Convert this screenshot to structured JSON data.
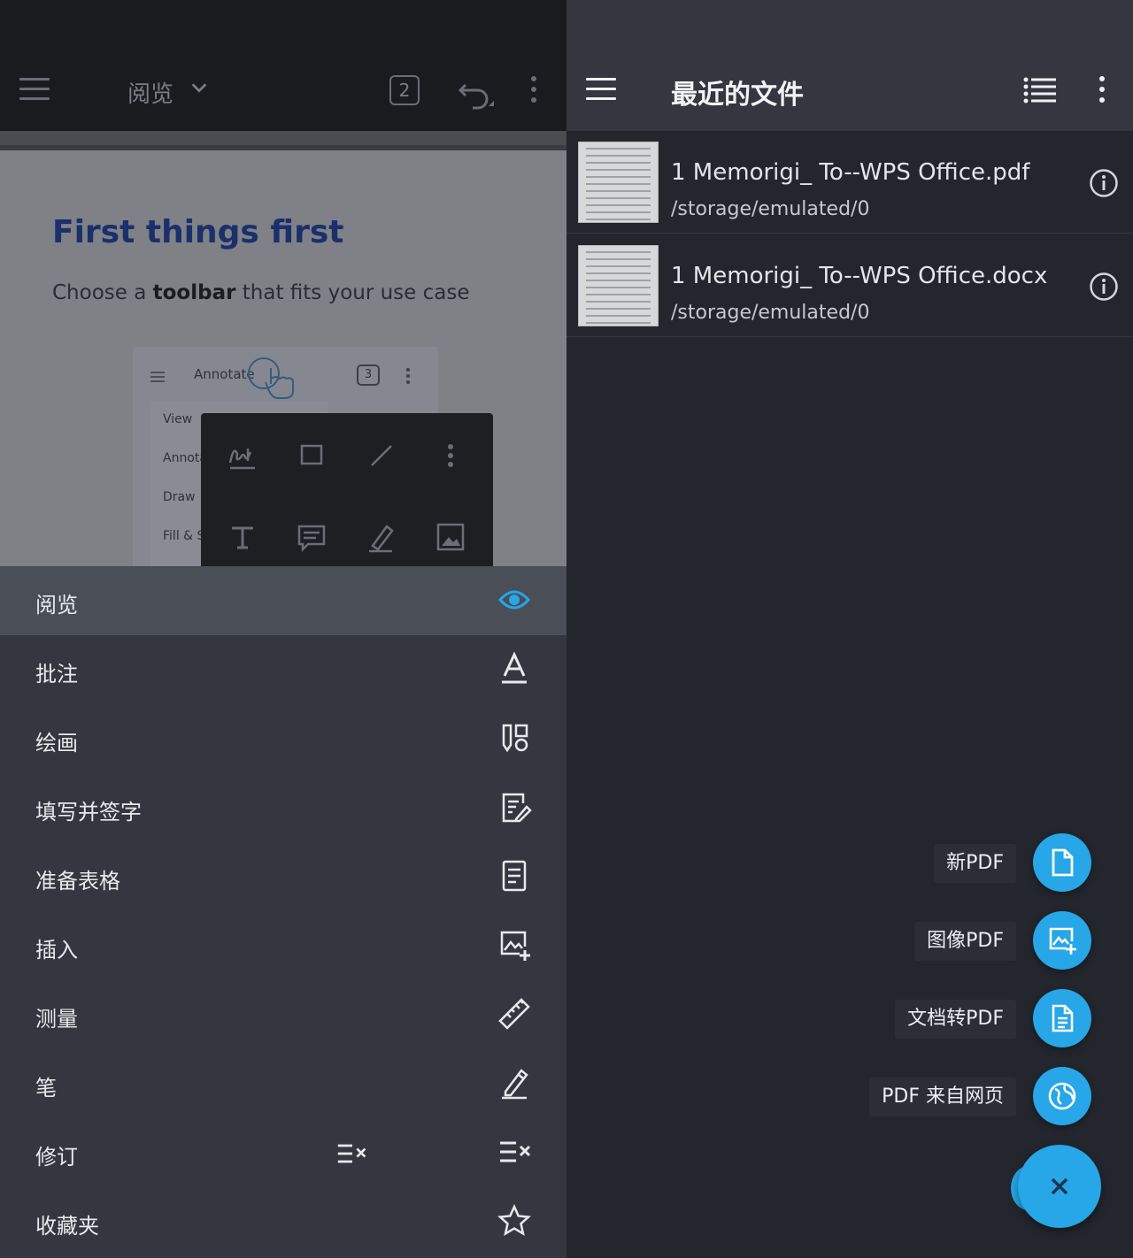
{
  "left": {
    "topbar": {
      "mode_label": "阅览",
      "page_count": "2"
    },
    "preview": {
      "title": "First things first",
      "subtitle_pre": "Choose a ",
      "subtitle_bold": "toolbar",
      "subtitle_post": " that fits your use case",
      "card": {
        "mode_label": "Annotate",
        "badge": "3",
        "menu_items": [
          "View",
          "Annota",
          "Draw",
          "Fill & S"
        ]
      }
    },
    "menu": [
      {
        "label": "阅览",
        "icon": "eye-icon",
        "active": true
      },
      {
        "label": "批注",
        "icon": "text-annotate-icon"
      },
      {
        "label": "绘画",
        "icon": "draw-tools-icon"
      },
      {
        "label": "填写并签字",
        "icon": "fill-sign-icon"
      },
      {
        "label": "准备表格",
        "icon": "form-icon"
      },
      {
        "label": "插入",
        "icon": "insert-image-icon"
      },
      {
        "label": "测量",
        "icon": "ruler-icon"
      },
      {
        "label": "笔",
        "icon": "pen-icon"
      },
      {
        "label": "修订",
        "icon": "redact-icon"
      },
      {
        "label": "收藏夹",
        "icon": "star-icon"
      }
    ],
    "colors": {
      "accent": "#27a6e8",
      "menu_bg": "#34373f",
      "active_bg": "#4a4e57"
    }
  },
  "right": {
    "topbar": {
      "title": "最近的文件"
    },
    "files": [
      {
        "name": "1 Memorigi_ To--WPS Office.pdf",
        "path": "/storage/emulated/0"
      },
      {
        "name": "1 Memorigi_ To--WPS Office.docx",
        "path": "/storage/emulated/0"
      }
    ],
    "fab_actions": [
      {
        "label": "新PDF",
        "icon": "new-file-icon"
      },
      {
        "label": "图像PDF",
        "icon": "image-add-icon"
      },
      {
        "label": "文档转PDF",
        "icon": "document-icon"
      },
      {
        "label": "PDF 来自网页",
        "icon": "globe-icon"
      }
    ],
    "colors": {
      "fab": "#27a6e8",
      "bg": "#23262d",
      "topbar": "#34373f"
    }
  }
}
